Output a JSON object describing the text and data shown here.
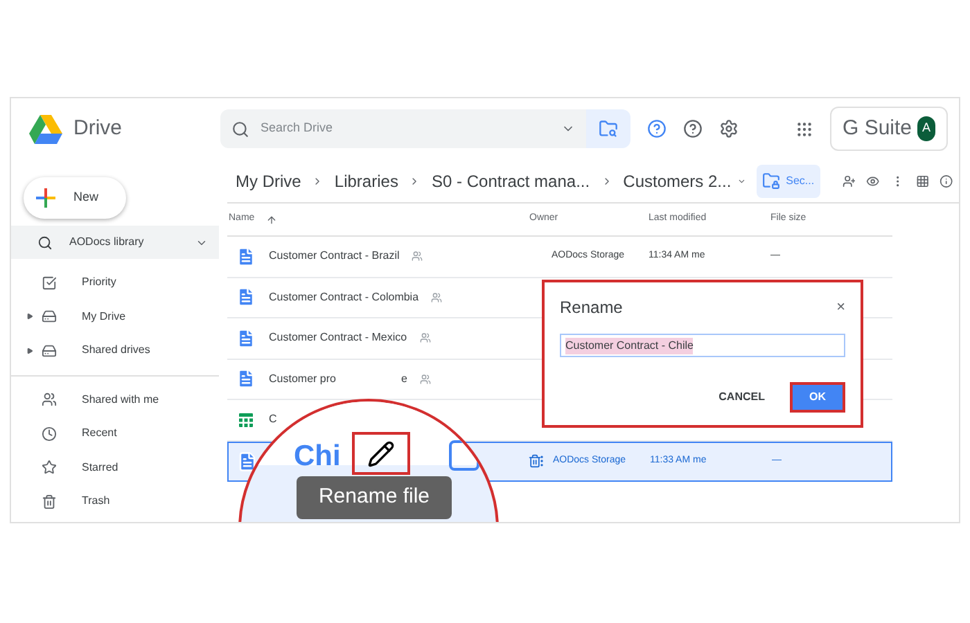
{
  "app": {
    "name": "Drive"
  },
  "search": {
    "placeholder": "Search Drive"
  },
  "account": {
    "brand": "G Suite",
    "avatar": "A"
  },
  "new_button": "New",
  "library": "AODocs library",
  "sidebar": {
    "items": [
      {
        "label": "Priority",
        "expandable": false
      },
      {
        "label": "My Drive",
        "expandable": true
      },
      {
        "label": "Shared drives",
        "expandable": true
      }
    ],
    "items2": [
      {
        "label": "Shared with me"
      },
      {
        "label": "Recent"
      },
      {
        "label": "Starred"
      },
      {
        "label": "Trash"
      }
    ]
  },
  "breadcrumb": [
    "My Drive",
    "Libraries",
    "S0 - Contract mana...",
    "Customers 2..."
  ],
  "security_button": "Sec...",
  "table": {
    "columns": [
      "Name",
      "Owner",
      "Last modified",
      "File size"
    ],
    "rows": [
      {
        "kind": "doc",
        "name": "Customer Contract - Brazil",
        "shared": true,
        "owner": "AODocs Storage",
        "modified": "11:34 AM me",
        "size": "—",
        "selected": false
      },
      {
        "kind": "doc",
        "name": "Customer Contract - Colombia",
        "shared": true,
        "selected": false
      },
      {
        "kind": "doc",
        "name": "Customer Contract - Mexico",
        "shared": true,
        "selected": false
      },
      {
        "kind": "doc",
        "name": "Customer pro",
        "tail": "e",
        "shared": true,
        "selected": false
      },
      {
        "kind": "sheet",
        "name": "C",
        "shared": false,
        "selected": false
      },
      {
        "kind": "doc",
        "name": "",
        "shared": false,
        "owner": "AODocs Storage",
        "modified": "11:33 AM me",
        "size": "—",
        "selected": true
      }
    ]
  },
  "magnifier": {
    "text": "Chi",
    "tooltip": "Rename file"
  },
  "dialog": {
    "title": "Rename",
    "close": "×",
    "value": "Customer Contract - Chile",
    "cancel": "CANCEL",
    "ok": "OK"
  }
}
